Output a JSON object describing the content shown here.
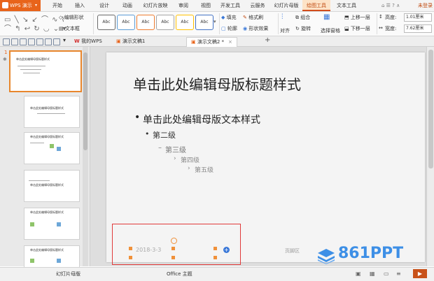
{
  "menubar": {
    "app_label": "WPS 演示",
    "items": [
      "开始",
      "插入",
      "设计",
      "动画",
      "幻灯片放映",
      "审阅",
      "视图",
      "开发工具",
      "云服务",
      "幻灯片母版",
      "绘图工具",
      "文本工具"
    ],
    "login": "未登录"
  },
  "ribbon": {
    "edit_shape": "编辑形状",
    "text_box": "文本框",
    "style_label": "Abc",
    "fill": "填充",
    "format_brush": "格式刷",
    "outline": "轮廓",
    "shape_effect": "形状效果",
    "align": "对齐",
    "rotate": "旋转",
    "group": "组合",
    "select_pane": "选择窗格",
    "bring_forward": "上移一层",
    "send_backward": "下移一层",
    "height_label": "高度:",
    "height_value": "1.01厘米",
    "width_label": "宽度:",
    "width_value": "7.62厘米"
  },
  "tabs": {
    "mywps": "我的WPS",
    "doc1": "演示文稿1",
    "doc2": "演示文稿2 *",
    "add": "+"
  },
  "thumbnails": {
    "master_number": "1",
    "master_title": "单击此处编辑母版标题样式",
    "layout_title": "单击此处编辑母版标题样式"
  },
  "slide": {
    "title": "单击此处编辑母版标题样式",
    "level1": "单击此处编辑母版文本样式",
    "level2": "第二级",
    "level3": "第三级",
    "level4": "第四级",
    "level5": "第五级",
    "date": "2018-3-3",
    "footer": "页脚区"
  },
  "watermark": "861PPT",
  "status": {
    "left": "幻灯片母版",
    "theme": "Office 主题"
  },
  "colors": {
    "accent": "#e8641b",
    "highlight": "#e03a3a",
    "handle": "#f0913a",
    "watermark": "#3d8fe6"
  }
}
